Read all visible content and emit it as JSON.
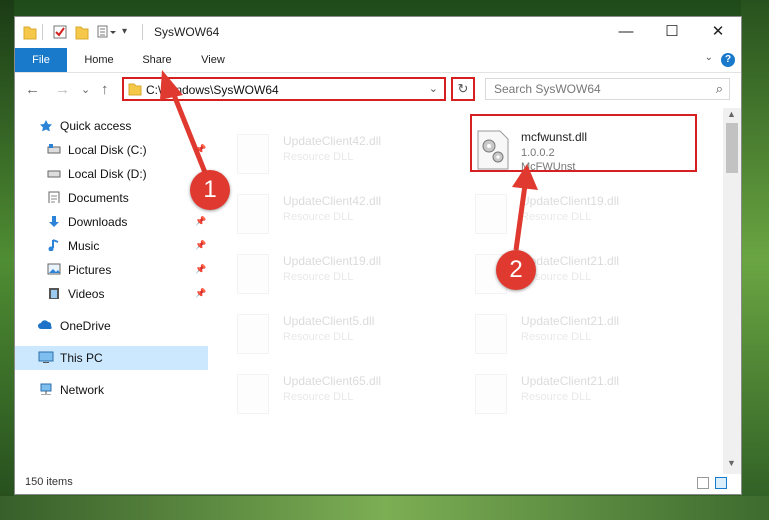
{
  "window": {
    "title": "SysWOW64"
  },
  "titlebar_buttons": {
    "minimize": "—",
    "maximize": "☐",
    "close": "✕"
  },
  "ribbon": {
    "tabs": [
      "File",
      "Home",
      "Share",
      "View"
    ],
    "help": "?",
    "expand": "⌄"
  },
  "nav": {
    "back": "←",
    "forward": "→",
    "recent": "⌄",
    "up": "↑"
  },
  "address": {
    "path": "C:\\Windows\\SysWOW64",
    "dropdown": "⌄",
    "refresh": "↻"
  },
  "search": {
    "placeholder": "Search SysWOW64",
    "icon": "⌕"
  },
  "sidebar": {
    "items": [
      {
        "label": "Quick access",
        "icon": "star-icon",
        "pinned": false
      },
      {
        "label": "Local Disk (C:)",
        "icon": "drive-icon",
        "pinned": true
      },
      {
        "label": "Local Disk (D:)",
        "icon": "drive-icon",
        "pinned": false
      },
      {
        "label": "Documents",
        "icon": "documents-icon",
        "pinned": true
      },
      {
        "label": "Downloads",
        "icon": "download-icon",
        "pinned": true
      },
      {
        "label": "Music",
        "icon": "music-icon",
        "pinned": true
      },
      {
        "label": "Pictures",
        "icon": "pictures-icon",
        "pinned": true
      },
      {
        "label": "Videos",
        "icon": "videos-icon",
        "pinned": true
      },
      {
        "label": "OneDrive",
        "icon": "cloud-icon",
        "pinned": false
      },
      {
        "label": "This PC",
        "icon": "computer-icon",
        "pinned": false,
        "selected": true
      },
      {
        "label": "Network",
        "icon": "network-icon",
        "pinned": false
      }
    ],
    "pin_glyph": "📌"
  },
  "files": {
    "left": [
      {
        "name": "UpdateClient42.dll",
        "type": "Resource DLL"
      },
      {
        "name": "UpdateClient42.dll",
        "type": "Resource DLL"
      },
      {
        "name": "UpdateClient19.dll",
        "type": "Resource DLL"
      },
      {
        "name": "UpdateClient5.dll",
        "type": "Resource DLL"
      },
      {
        "name": "UpdateClient65.dll",
        "type": "Resource DLL"
      }
    ],
    "right": [
      {
        "name": "mcfwunst.dll",
        "version": "1.0.0.2",
        "description": "McFWUnst"
      },
      {
        "name": "UpdateClient19.dll",
        "type": "Resource DLL"
      },
      {
        "name": "UpdateClient21.dll",
        "type": "Resource DLL"
      },
      {
        "name": "UpdateClient21.dll",
        "type": "Resource DLL"
      },
      {
        "name": "UpdateClient21.dll",
        "type": "Resource DLL"
      }
    ]
  },
  "status": {
    "item_count": "150 items"
  },
  "annotations": {
    "step1": "1",
    "step2": "2",
    "color": "#e0392f"
  },
  "colors": {
    "accent": "#1979ca",
    "highlight": "#d62020",
    "selection": "#cce8ff"
  }
}
